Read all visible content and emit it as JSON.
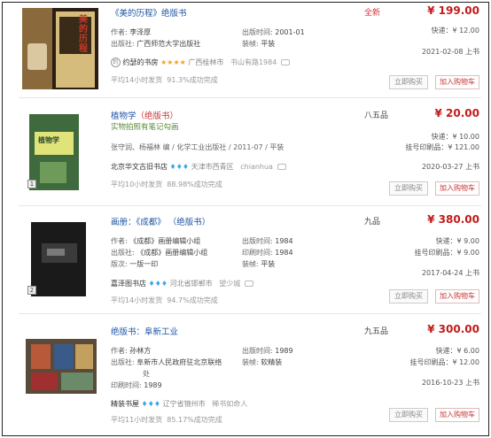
{
  "items": [
    {
      "title": "《美的历程》",
      "tag": "绝版书",
      "condition": "全新",
      "price": "¥ 199.00",
      "author_label": "作者:",
      "author": "李泽厚",
      "publisher_label": "出版社:",
      "publisher": "广西师范大学出版社",
      "pubtime_label": "出版时间:",
      "pubtime": "2001-01",
      "binding_label": "装帧:",
      "binding": "平装",
      "shipping": "快递：¥ 12.00",
      "listed": "2021-02-08 上书",
      "shop": "约瑟的书房",
      "shop_badge": "约",
      "rating": "★★★★",
      "location": "广西桂林市",
      "seller": "书山有路1984",
      "ship_speed": "平均14小时发货",
      "success_rate": "91.3%成功完成",
      "buy_now": "立即购买",
      "add_cart": "加入购物车",
      "cover_title": "美的历程"
    },
    {
      "title": "植物学",
      "tag": "（绝版书）",
      "subtitle": "实物拍照有笔记勾画",
      "condition": "八五品",
      "price": "¥ 20.00",
      "byline": "张守润、杨福林 编 / 化学工业出版社 / 2011-07 / 平装",
      "shipping": "快递：¥ 10.00",
      "shipping2": "挂号印刷品：¥ 121.00",
      "listed": "2020-03-27 上书",
      "shop": "北京华文古旧书店",
      "rating": "♦♦♦",
      "location": "天津市西青区",
      "seller": "chianhua",
      "ship_speed": "平均10小时发货",
      "success_rate": "88.98%成功完成",
      "buy_now": "立即购买",
      "add_cart": "加入购物车",
      "cover_title": "植物学",
      "thumb_num": "1"
    },
    {
      "title": "画册：《成都》",
      "tag": "（绝版书）",
      "condition": "九品",
      "price": "¥ 380.00",
      "author_label": "作者:",
      "author": "《成都》画册编辑小组",
      "publisher_label": "出版社:",
      "publisher": "《成都》画册编辑小组",
      "edition_label": "版次:",
      "edition": "一版一印",
      "pubtime_label": "出版时间:",
      "pubtime": "1984",
      "printtime_label": "印刷时间:",
      "printtime": "1984",
      "binding_label": "装帧:",
      "binding": "平装",
      "shipping": "快递：¥ 9.00",
      "shipping2": "挂号印刷品：¥ 9.00",
      "listed": "2017-04-24 上书",
      "shop": "嘉泽图书店",
      "rating": "♦♦♦",
      "location": "河北省邯郸市",
      "seller": "望少城",
      "ship_speed": "平均14小时发货",
      "success_rate": "94.7%成功完成",
      "buy_now": "立即购买",
      "add_cart": "加入购物车",
      "thumb_num": "2"
    },
    {
      "title": "绝版书：阜新工业",
      "condition": "九五品",
      "price": "¥ 300.00",
      "author_label": "作者:",
      "author": "孙林方",
      "publisher_label": "出版社:",
      "publisher": "阜新市人民政府驻北京联络",
      "publisher_cont": "处",
      "printtime_label": "印刷时间:",
      "printtime": "1989",
      "pubtime_label": "出版时间:",
      "pubtime": "1989",
      "binding_label": "装帧:",
      "binding": "软精装",
      "shipping": "快递：¥ 6.00",
      "shipping2": "挂号印刷品：¥ 12.00",
      "listed": "2016-10-23 上书",
      "shop": "精装书屋",
      "rating": "♦♦♦",
      "location": "辽宁省锦州市",
      "seller": "稀书如命人",
      "ship_speed": "平均11小时发货",
      "success_rate": "85.17%成功完成",
      "buy_now": "立即购买",
      "add_cart": "加入购物车"
    }
  ]
}
